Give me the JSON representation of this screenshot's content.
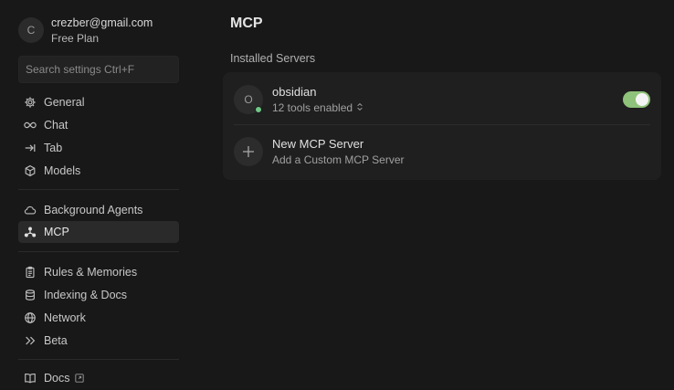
{
  "account": {
    "avatar_letter": "C",
    "email": "crezber@gmail.com",
    "plan": "Free Plan"
  },
  "search": {
    "placeholder": "Search settings Ctrl+F"
  },
  "sidebar": {
    "items": [
      {
        "label": "General",
        "icon": "gear-icon"
      },
      {
        "label": "Chat",
        "icon": "infinity-icon"
      },
      {
        "label": "Tab",
        "icon": "tab-arrow-icon"
      },
      {
        "label": "Models",
        "icon": "cube-icon"
      },
      {
        "label": "Background Agents",
        "icon": "cloud-icon"
      },
      {
        "label": "MCP",
        "icon": "mcp-icon",
        "active": true
      },
      {
        "label": "Rules & Memories",
        "icon": "clipboard-icon"
      },
      {
        "label": "Indexing & Docs",
        "icon": "database-icon"
      },
      {
        "label": "Network",
        "icon": "globe-icon"
      },
      {
        "label": "Beta",
        "icon": "double-chevron-icon"
      },
      {
        "label": "Docs",
        "icon": "book-icon"
      }
    ]
  },
  "main": {
    "title": "MCP",
    "section_label": "Installed Servers",
    "servers": [
      {
        "avatar_letter": "O",
        "name": "obsidian",
        "tools": "12 tools enabled",
        "status": "connected",
        "enabled": true
      }
    ],
    "new_server": {
      "title": "New MCP Server",
      "subtitle": "Add a Custom MCP Server"
    }
  },
  "colors": {
    "background": "#181818",
    "card": "#1f1f1f",
    "toggle_on": "#8fc27a",
    "status_ok": "#6fc987"
  }
}
